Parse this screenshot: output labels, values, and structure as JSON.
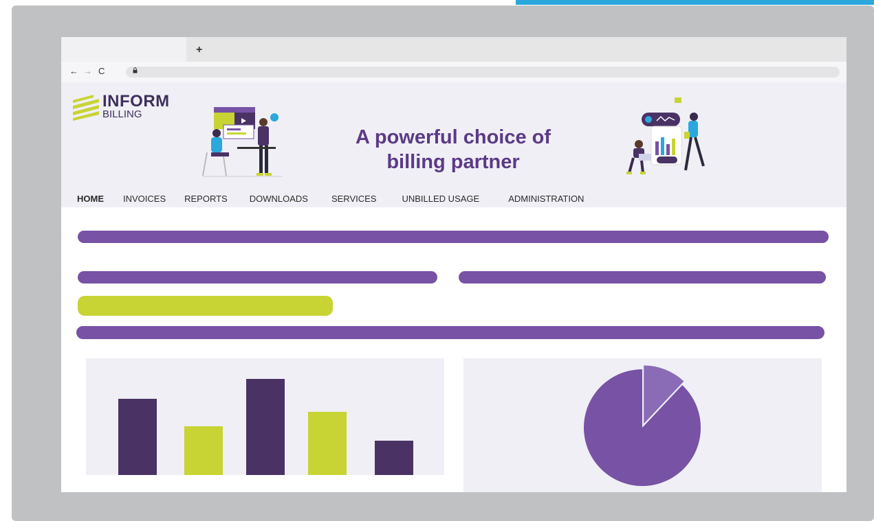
{
  "browser": {
    "new_tab_symbol": "+",
    "nav": {
      "back": "←",
      "forward": "→",
      "reload": "C"
    },
    "lock_symbol": "🔒"
  },
  "brand": {
    "line1": "INFORM",
    "line2": "BILLING",
    "colors": {
      "dark": "#3e2f5c",
      "lime": "#c8d433"
    }
  },
  "header": {
    "headline": "A powerful choice of billing partner"
  },
  "menu": {
    "items": [
      "HOME",
      "INVOICES",
      "REPORTS",
      "DOWNLOADS",
      "SERVICES",
      "UNBILLED USAGE",
      "ADMINISTRATION"
    ],
    "active": "HOME"
  },
  "colors": {
    "purple": "#7752a5",
    "dark_purple": "#4a3265",
    "lime": "#c8d433",
    "panel": "#efeff5",
    "accent_blue": "#2aa7dd"
  },
  "chart_data": [
    {
      "type": "bar",
      "categories": [
        "",
        "",
        "",
        "",
        ""
      ],
      "values": [
        111,
        71,
        140,
        92,
        50
      ],
      "colors": [
        "#4a3265",
        "#c8d433",
        "#4a3265",
        "#c8d433",
        "#4a3265"
      ],
      "ylim": [
        0,
        170
      ],
      "grid": false
    },
    {
      "type": "pie",
      "values": [
        88,
        12
      ],
      "colors": [
        "#7752a5",
        "#8a6bb5"
      ],
      "exploded_slice": 1
    }
  ]
}
